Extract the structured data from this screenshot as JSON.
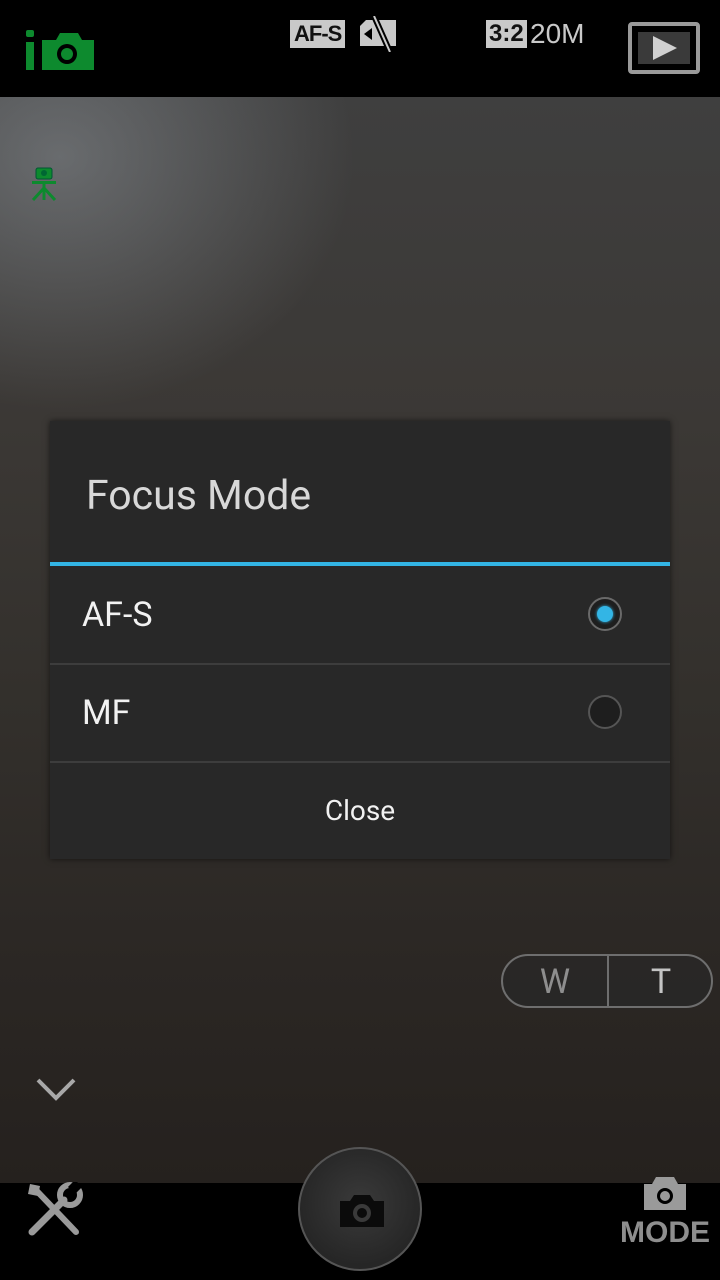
{
  "status_bar": {
    "mode_icon": "intelligent-auto-camera-icon",
    "focus_mode": "AF-S",
    "card_icon": "no-memory-card-icon",
    "aspect_ratio": "3:2",
    "resolution": "20M",
    "playback_icon": "playback-icon"
  },
  "viewfinder": {
    "tripod_icon": "tripod-icon",
    "zoom": {
      "wide_label": "W",
      "tele_label": "T"
    },
    "expand_icon": "chevron-down-icon"
  },
  "dialog": {
    "title": "Focus Mode",
    "options": [
      {
        "label": "AF-S",
        "selected": true
      },
      {
        "label": "MF",
        "selected": false
      }
    ],
    "close_label": "Close",
    "accent_color": "#33b5e5"
  },
  "bottom_bar": {
    "tools_icon": "wrench-screwdriver-icon",
    "shutter_icon": "camera-icon",
    "mode_label": "MODE"
  }
}
